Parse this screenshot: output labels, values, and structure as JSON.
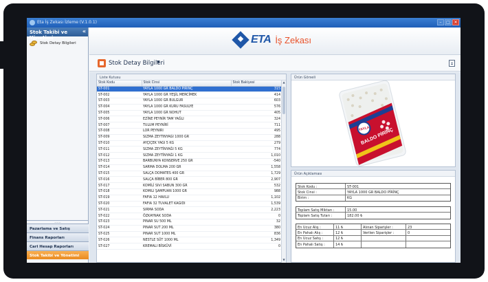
{
  "window": {
    "title": "Eta İş Zekası İzleme (V.1.0.1)"
  },
  "sidebar": {
    "header": "Stok Takibi ve Yönetimi",
    "collapse_glyph": "«",
    "item": "Stok Detay Bilgileri",
    "grip": "......",
    "nav": [
      "Pazarlama ve Satış",
      "Finans Raporları",
      "Cari Hesap Raporları",
      "Stok Takibi ve Yönetimi"
    ]
  },
  "brand": {
    "name": "ETA",
    "tagline": "İş Zekası"
  },
  "page": {
    "title": "Stok Detay Bilgileri",
    "caret": "▼"
  },
  "list": {
    "label": "Liste Kutusu",
    "columns": [
      "Stok Kodu",
      "Stok Cinsi",
      "Stok Bakiyesi"
    ],
    "rows": [
      [
        "ST-001",
        "YAYLA 1000 GR BALDO PİRİNÇ",
        "315"
      ],
      [
        "ST-002",
        "YAYLA 1000 GR YEŞİL MERCİMEK",
        "414"
      ],
      [
        "ST-003",
        "YAYLA 1000 GR BULGUR",
        "603"
      ],
      [
        "ST-004",
        "YAYLA 1000 GR KURU FASÜLYE",
        "576"
      ],
      [
        "ST-005",
        "YAYLA 1000 GR NOHUT",
        "405"
      ],
      [
        "ST-006",
        "EZİNE PEYNİR TAM YAĞLI",
        "324"
      ],
      [
        "ST-007",
        "TULUM PEYNİRİ",
        "711"
      ],
      [
        "ST-008",
        "LOR PEYNİRİ",
        "495"
      ],
      [
        "ST-009",
        "SIZMA ZEYTİNYAĞI 1000 GR",
        "288"
      ],
      [
        "ST-010",
        "AYÇİÇEK YAĞI 5 KG",
        "279"
      ],
      [
        "ST-011",
        "SIZMA ZEYTİNYAĞI 5 KG",
        "774"
      ],
      [
        "ST-012",
        "SIZMA ZEYTİNYAĞI 1 KG",
        "1,010"
      ],
      [
        "ST-013",
        "BARBUNYA KONSERVE 250 GR",
        "-540"
      ],
      [
        "ST-014",
        "SARMA DOLMA 200 GR",
        "1,558"
      ],
      [
        "ST-015",
        "SALÇA DOMATES 400 GR",
        "1,729"
      ],
      [
        "ST-016",
        "SALÇA BİBER 800 GR",
        "2,907"
      ],
      [
        "ST-017",
        "KOMİLİ SIVI SABUN 300 GR",
        "532"
      ],
      [
        "ST-018",
        "KOMİLİ ŞAMPUAN 1000 GR",
        "988"
      ],
      [
        "ST-019",
        "FAFİA 12 HAVLU",
        "1,102"
      ],
      [
        "ST-020",
        "FAFİA 32 TUVALET KAĞIDI",
        "1,539"
      ],
      [
        "ST-021",
        "SIRMA SODA",
        "2,223"
      ],
      [
        "ST-022",
        "ÖZKAYNAK SODA",
        "0"
      ],
      [
        "ST-023",
        "PINAR SU 500 ML",
        "32"
      ],
      [
        "ST-024",
        "PINAR SÜT 200 ML",
        "380"
      ],
      [
        "ST-025",
        "PINAR SÜT 1000 ML",
        "836"
      ],
      [
        "ST-026",
        "NESTLE SÜT 1000 ML",
        "1,349"
      ],
      [
        "ST-027",
        "KREMALI BİSKÜVİ",
        "0"
      ]
    ]
  },
  "image_panel": {
    "label": "Ürün Görseli",
    "package_text": "BALDO PİRİNÇ",
    "brand_text": "YAYLA"
  },
  "desc_panel": {
    "label": "Ürün Açıklaması",
    "kodu_label": "Stok Kodu :",
    "kodu_value": "ST-001",
    "cinsi_label": "Stok Cinsi :",
    "cinsi_value": "YAYLA 1000 GR BALDO PİRİNÇ",
    "birim_label": "Birim :",
    "birim_value": "KG",
    "miktar_label": "Toplam Satış Miktarı :",
    "miktar_value": "15.00",
    "tutar_label": "Toplam Satış Tutarı :",
    "tutar_value": "182.00 ₺",
    "ucuz_alis_label": "En Ucuz Alış :",
    "ucuz_alis_value": "11 ₺",
    "pahali_alis_label": "En Pahalı Alış :",
    "pahali_alis_value": "12 ₺",
    "ucuz_satis_label": "En Ucuz Satış :",
    "ucuz_satis_value": "12 ₺",
    "pahali_satis_label": "En Pahalı Satış :",
    "pahali_satis_value": "14 ₺",
    "alinan_label": "Alınan Siparişler :",
    "alinan_value": "23",
    "verilen_label": "Verilen Siparişler :",
    "verilen_value": "0"
  },
  "colors": {
    "accent": "#2f6fd0",
    "brand_blue": "#1f57a8",
    "brand_orange": "#e8522a",
    "active_nav": "#e98a20"
  }
}
